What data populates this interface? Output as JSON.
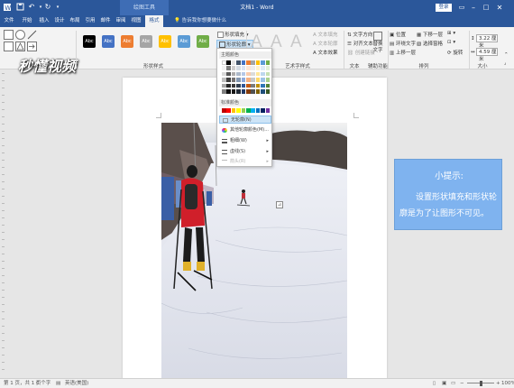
{
  "window": {
    "title": "文档1 - Word",
    "context_group": "绘图工具",
    "login_label": "登录"
  },
  "tabs": [
    {
      "label": "文件"
    },
    {
      "label": "开始"
    },
    {
      "label": "插入"
    },
    {
      "label": "设计"
    },
    {
      "label": "布局"
    },
    {
      "label": "引用"
    },
    {
      "label": "邮件"
    },
    {
      "label": "审阅"
    },
    {
      "label": "视图"
    },
    {
      "label": "格式"
    }
  ],
  "tell_me": "告诉我你想要做什么",
  "ribbon": {
    "groups": {
      "insert_shapes": "插入形状",
      "shape_styles": "形状样式",
      "wordart_styles": "艺术字样式",
      "text": "文本",
      "accessibility": "辅助功能",
      "arrange": "排列",
      "size": "大小"
    },
    "style_swatch_label": "Abc",
    "style_colors": [
      "#000000",
      "#4472c4",
      "#ed7d31",
      "#a5a5a5",
      "#ffc000",
      "#5b9bd5",
      "#70ad47"
    ],
    "shape_fill": "形状填充",
    "shape_outline": "形状轮廓",
    "text_fill": "文本填充",
    "text_outline": "文本轮廓",
    "text_effects": "文本效果",
    "text_direction": "文字方向",
    "align_text": "对齐文本",
    "create_link": "创建链接",
    "alt_text": "替换文字",
    "position": "位置",
    "wrap_text": "环绕文字",
    "bring_forward": "上移一层",
    "send_backward": "下移一层",
    "selection_pane": "选择窗格",
    "rotate": "旋转",
    "height": "3.22 厘米",
    "width": "4.59 厘米"
  },
  "dropdown": {
    "theme_colors_label": "主题颜色",
    "standard_colors_label": "标准颜色",
    "theme_colors": [
      [
        "#ffffff",
        "#000000",
        "#e7e6e6",
        "#44546a",
        "#4472c4",
        "#ed7d31",
        "#a5a5a5",
        "#ffc000",
        "#5b9bd5",
        "#70ad47"
      ],
      [
        "#f2f2f2",
        "#7f7f7f",
        "#d0cece",
        "#d6dce4",
        "#dae3f3",
        "#fbe5d6",
        "#ededed",
        "#fff2cc",
        "#deebf7",
        "#e2f0d9"
      ],
      [
        "#d9d9d9",
        "#595959",
        "#aeabab",
        "#adb9ca",
        "#b4c7e7",
        "#f8cbad",
        "#dbdbdb",
        "#ffe699",
        "#bdd7ee",
        "#c5e0b4"
      ],
      [
        "#bfbfbf",
        "#3f3f3f",
        "#757171",
        "#8497b0",
        "#8faadc",
        "#f4b183",
        "#c9c9c9",
        "#ffd966",
        "#9dc3e6",
        "#a9d18e"
      ],
      [
        "#a6a6a6",
        "#262626",
        "#3a3838",
        "#333f50",
        "#2f5597",
        "#c55a11",
        "#7b7b7b",
        "#bf9000",
        "#2e75b6",
        "#548235"
      ],
      [
        "#7f7f7f",
        "#0d0d0d",
        "#171616",
        "#222a35",
        "#203864",
        "#843c0c",
        "#525252",
        "#7f6000",
        "#1f4e79",
        "#385723"
      ]
    ],
    "standard_colors": [
      "#c00000",
      "#ff0000",
      "#ffc000",
      "#ffff00",
      "#92d050",
      "#00b050",
      "#00b0f0",
      "#0070c0",
      "#002060",
      "#7030a0"
    ],
    "no_outline": "无轮廓(N)",
    "more_colors": "其他轮廓颜色(M)...",
    "weight": "粗细(W)",
    "dashes": "虚线(S)",
    "arrows": "箭头(R)"
  },
  "tip": {
    "title": "小提示:",
    "body": "设置形状填充和形状轮廓是为了让图形不可见。"
  },
  "watermark": {
    "main": "秒懂视频"
  },
  "status": {
    "page": "第 1 页，共 1 页",
    "words": "0 个字",
    "language": "英语(美国)",
    "zoom": "100%"
  }
}
